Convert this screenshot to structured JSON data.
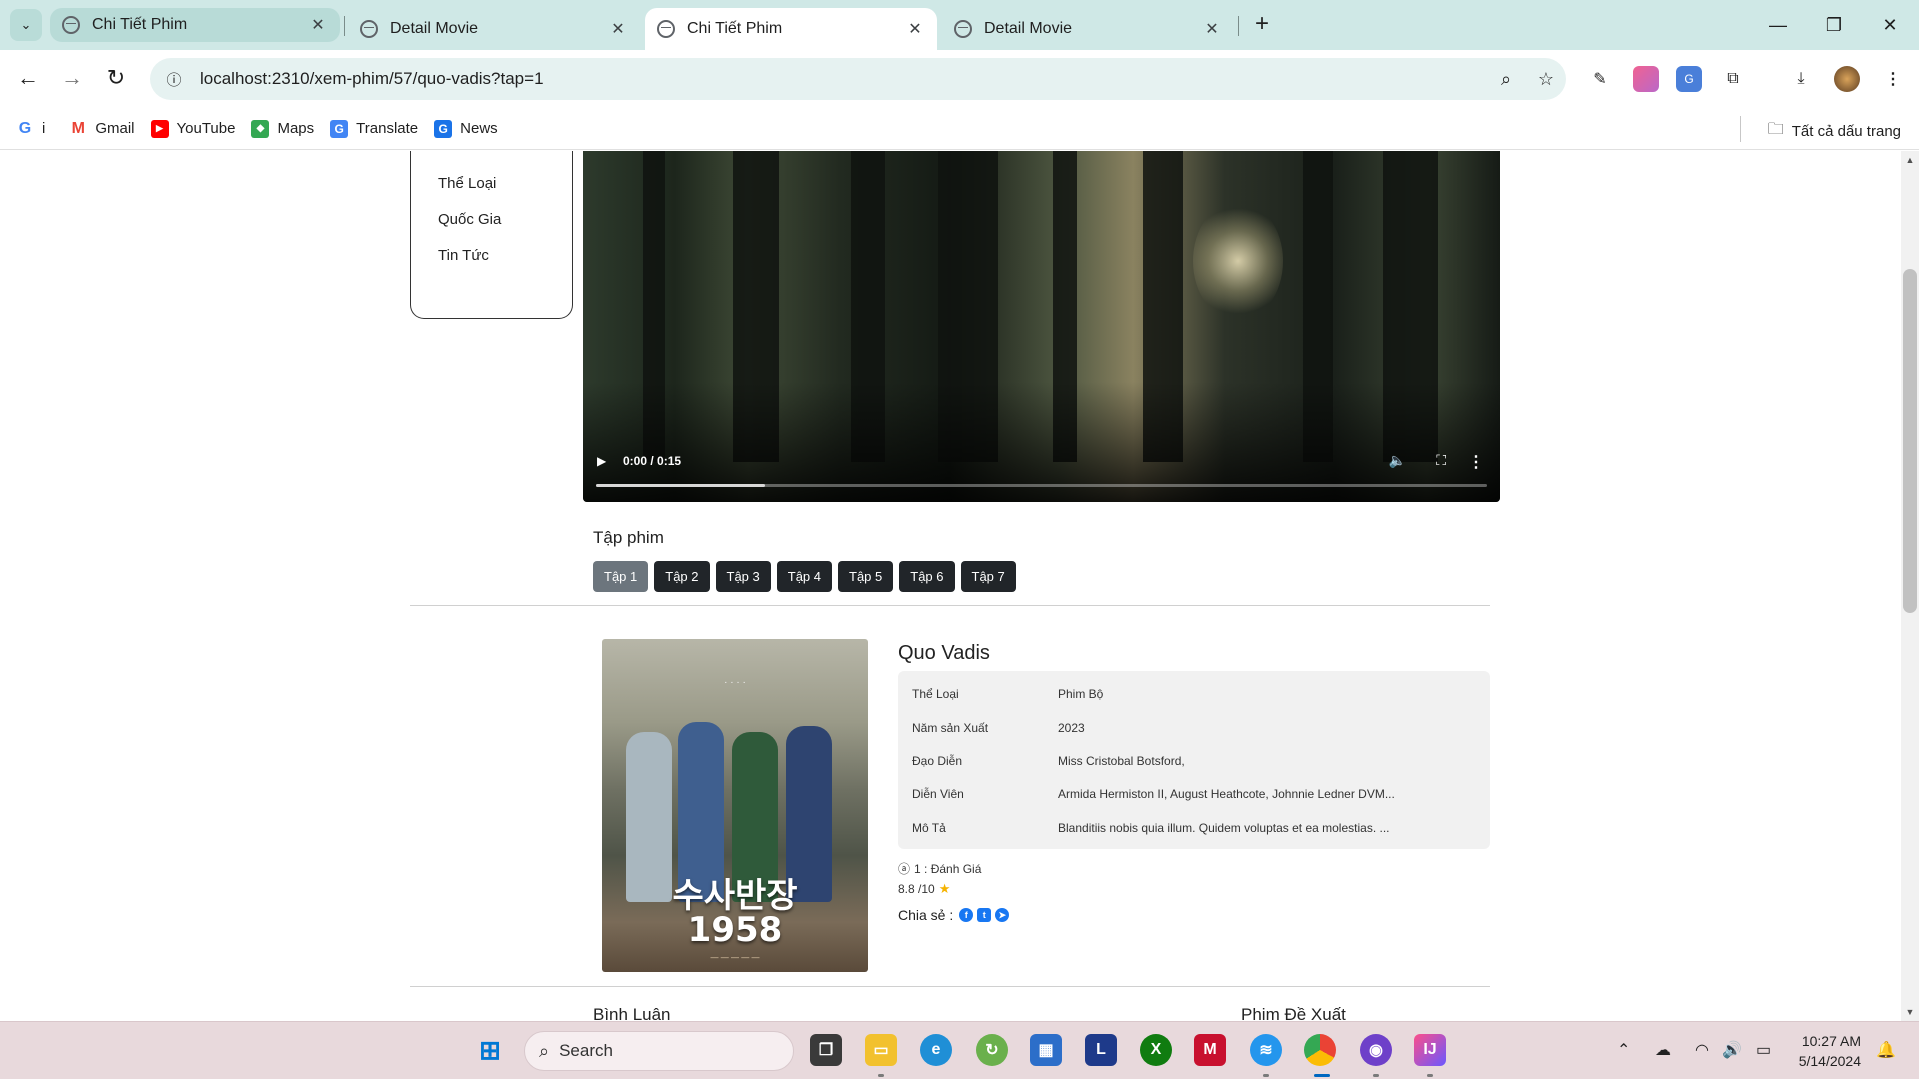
{
  "browser": {
    "tabs": [
      {
        "title": "Chi Tiết Phim",
        "state": "hover"
      },
      {
        "title": "Detail Movie",
        "state": "normal"
      },
      {
        "title": "Chi Tiết Phim",
        "state": "active"
      },
      {
        "title": "Detail Movie",
        "state": "normal"
      }
    ],
    "tab_close": "✕",
    "new_tab": "+",
    "url": "localhost:2310/xem-phim/57/quo-vadis?tap=1",
    "bookmarks": [
      {
        "label": "i",
        "icon": "google-icon",
        "color": "#4285f4",
        "glyph": "G"
      },
      {
        "label": "Gmail",
        "icon": "gmail-icon",
        "color": "#ea4335",
        "glyph": "M"
      },
      {
        "label": "YouTube",
        "icon": "youtube-icon",
        "color": "#ff0000",
        "glyph": "▶"
      },
      {
        "label": "Maps",
        "icon": "maps-icon",
        "color": "#34a853",
        "glyph": "◆"
      },
      {
        "label": "Translate",
        "icon": "translate-icon",
        "color": "#4285f4",
        "glyph": "G"
      },
      {
        "label": "News",
        "icon": "news-icon",
        "color": "#1a73e8",
        "glyph": "G"
      }
    ],
    "all_bookmarks": "Tất cả dấu trang"
  },
  "page": {
    "menu": [
      "Thể Loại",
      "Quốc Gia",
      "Tin Tức"
    ],
    "video": {
      "time": "0:00 / 0:15",
      "buffered_fraction": 0.19
    },
    "episodes_title": "Tập phim",
    "episodes": [
      "Tập 1",
      "Tập 2",
      "Tập 3",
      "Tập 4",
      "Tập 5",
      "Tập 6",
      "Tập 7"
    ],
    "active_episode": 0,
    "poster": {
      "title_line1": "수사반장",
      "title_line2": "1958"
    },
    "movie": {
      "name": "Quo Vadis",
      "fields": [
        {
          "key": "Thể Loại",
          "value": "Phim Bộ"
        },
        {
          "key": "Năm sản Xuất",
          "value": "2023"
        },
        {
          "key": "Đạo Diễn",
          "value": "Miss Cristobal Botsford,"
        },
        {
          "key": "Diễn Viên",
          "value": "Armida Hermiston II, August Heathcote, Johnnie Ledner DVM..."
        },
        {
          "key": "Mô Tả",
          "value": "Blanditiis nobis quia illum. Quidem voluptas et ea molestias. ..."
        }
      ],
      "reviews": "1 : Đánh Giá",
      "score": "8.8 /10",
      "share_label": "Chia sẻ :"
    },
    "comments_title": "Bình Luận",
    "suggested_title": "Phim Đề Xuất"
  },
  "taskbar": {
    "search": "Search",
    "time": "10:27 AM",
    "date": "5/14/2024"
  }
}
